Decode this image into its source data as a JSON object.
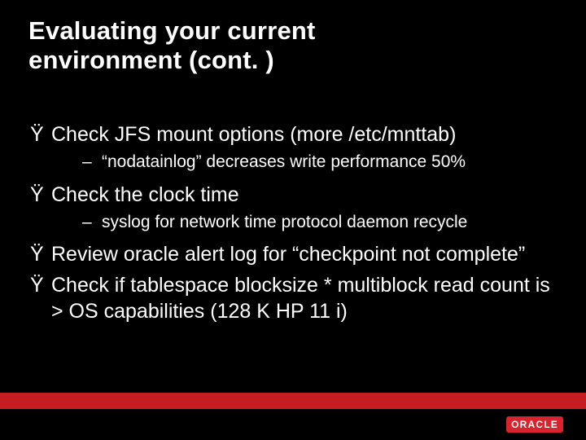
{
  "title_line1": "Evaluating your current",
  "title_line2": "environment (cont. )",
  "bullets": {
    "b1": {
      "mark": "Ÿ",
      "text": "Check JFS mount options (more /etc/mnttab)"
    },
    "b1s1": {
      "mark": "–",
      "text": "“nodatainlog” decreases write performance 50%"
    },
    "b2": {
      "mark": "Ÿ",
      "text": "Check the clock time"
    },
    "b2s1": {
      "mark": "–",
      "text": "syslog for network time protocol daemon recycle"
    },
    "b3": {
      "mark": "Ÿ",
      "text": "Review oracle alert log for “checkpoint not complete”"
    },
    "b4": {
      "mark": "Ÿ",
      "text": "Check if tablespace blocksize * multiblock read count is > OS capabilities (128 K HP 11 i)"
    }
  },
  "logo": "ORACLE"
}
